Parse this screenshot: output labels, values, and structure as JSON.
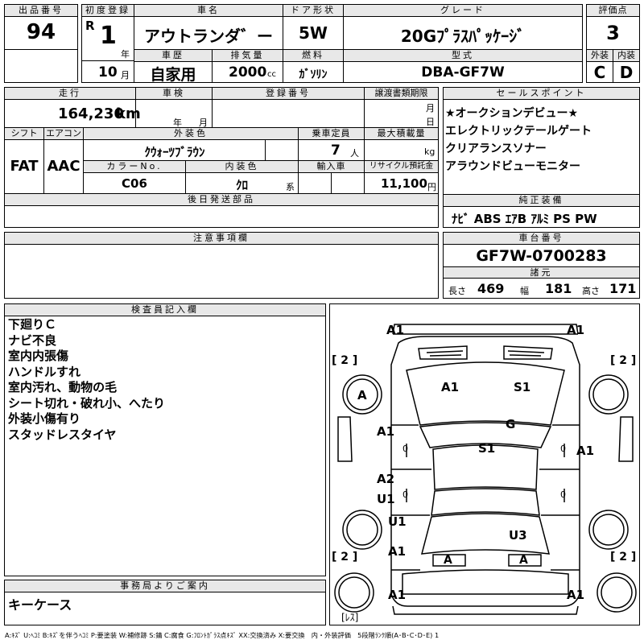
{
  "header": {
    "lot_label": "出品番号",
    "lot": "94",
    "reg_label": "初度登録",
    "era": "R",
    "reg_year": "1",
    "year_unit": "年",
    "reg_month": "10",
    "month_unit": "月",
    "car_name_label": "車名",
    "car_name": "アウトランダ゛ー",
    "history_label": "車歴",
    "history": "自家用",
    "doors_label": "ドア形状",
    "doors": "5W",
    "displacement_label": "排気量",
    "displacement": "2000",
    "cc_unit": "cc",
    "fuel_label": "燃料",
    "fuel": "ｶﾞｿﾘﾝ",
    "grade_label": "グレード",
    "grade": "20Gﾌﾟﾗｽﾊﾟｯｹｰｼﾞ",
    "model_label": "型式",
    "model": "DBA-GF7W",
    "score_label": "評価点",
    "score": "3",
    "ext_label": "外装",
    "ext": "C",
    "int_label": "内装",
    "int": "D"
  },
  "row2": {
    "mileage_label": "走行",
    "mileage": "164,230",
    "km_unit": "km",
    "inspection_label": "車検",
    "insp_year_unit": "年",
    "insp_month_unit": "月",
    "plate_label": "登録番号",
    "transfer_label": "譲渡書類期限",
    "transfer_month_unit": "月",
    "transfer_day_unit": "日",
    "shift_label": "シフト",
    "shift": "FAT",
    "ac_label": "エアコン",
    "ac": "AAC",
    "color_label": "外装色",
    "color": "ｸｳｫｰﾂﾌﾞﾗｳﾝ",
    "seats_label": "乗車定員",
    "seats": "7",
    "seats_unit": "人",
    "load_label": "最大積載量",
    "load_unit": "kg",
    "colorno_label": "カラーNo.",
    "colorno": "C06",
    "interior_label": "内装色",
    "interior": "ｸﾛ",
    "interior_unit": "系",
    "import_label": "輸入車",
    "recycle_label": "リサイクル預託金",
    "recycle": "11,100",
    "yen_unit": "円"
  },
  "sales_points": {
    "label": "セールスポイント",
    "items": [
      "★オークションデビュー★",
      "エレクトリックテールゲート",
      "クリアランスソナー",
      "アラウンドビューモニター"
    ]
  },
  "later_parts_label": "後日発送部品",
  "equipment": {
    "label": "純正装備",
    "items": "ﾅﾋﾞ ABS ｴｱB ｱﾙﾐ PS PW"
  },
  "notes_label": "注意事項欄",
  "chassis": {
    "label": "車台番号",
    "value": "GF7W-0700283"
  },
  "dimensions": {
    "label": "諸元",
    "length_label": "長さ",
    "length": "469",
    "width_label": "幅",
    "width": "181",
    "height_label": "高さ",
    "height": "171"
  },
  "inspector": {
    "label": "検査員記入欄",
    "lines": [
      "下廻りＣ",
      "ナビ不良",
      "室内内張傷",
      "ハンドルすれ",
      "室内汚れ、動物の毛",
      "シート切れ・破れ小、へたり",
      "外装小傷有り",
      "スタッドレスタイヤ"
    ]
  },
  "office": {
    "label": "事務局よりご案内",
    "text": "キーケース"
  },
  "diagram": {
    "marks": {
      "a1_fl": "A1",
      "a1_fr": "A1",
      "a1_hood": "A1",
      "s1_hood": "S1",
      "g": "G",
      "s1_roof": "S1",
      "a1_ldoor": "A1",
      "a1_rdoor": "A1",
      "a2": "A2",
      "u1_a": "U1",
      "u1_b": "U1",
      "a1_lr": "A1",
      "u3": "U3",
      "a_rl": "A",
      "a_rr": "A",
      "a1_bl": "A1",
      "a1_br": "A1",
      "a_ltire": "A",
      "zero_l1": "0",
      "zero_l2": "0",
      "zero_r1": "0",
      "zero_r2": "0"
    },
    "tread": {
      "fl": "[ 2 ]",
      "fr": "[ 2 ]",
      "rl": "[ 2 ]",
      "rr": "[ 2 ]"
    },
    "spare": "[ﾚｽ]"
  },
  "footer": "A:ｷｽﾞ U:ﾍｺﾐ B:ｷｽﾞを伴うﾍｺﾐ P:要塗装 W:補修跡 S:錆 C:腐食 G:ﾌﾛﾝﾄｶﾞﾗｽ点ｷｽﾞ XX:交換済み X:要交換　内・外装評価　5段階ﾗﾝｸ順(A･B･C･D･E) 1"
}
